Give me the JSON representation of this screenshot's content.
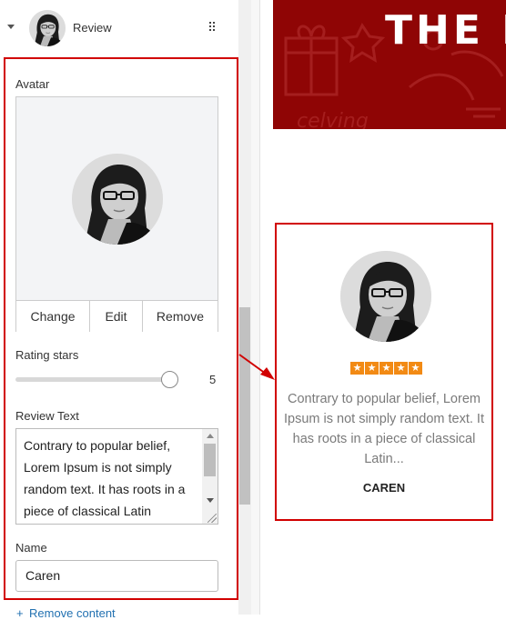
{
  "panel": {
    "header": {
      "title": "Review",
      "thumbnail_icon": "user-avatar-icon"
    },
    "avatar": {
      "label": "Avatar",
      "buttons": [
        "Change",
        "Edit",
        "Remove"
      ]
    },
    "rating": {
      "label": "Rating stars",
      "value": "5",
      "max": 5
    },
    "review_text": {
      "label": "Review Text",
      "value": "Contrary to popular belief, Lorem Ipsum is not simply random text. It has roots in a piece of classical Latin"
    },
    "name": {
      "label": "Name",
      "value": "Caren"
    },
    "remove_content_label": "Remove content"
  },
  "preview": {
    "banner_title": "THE R",
    "card": {
      "stars": 5,
      "text": "Contrary to popular belief, Lorem Ipsum is not simply random text. It has roots in a piece of classical Latin...",
      "name": "CAREN"
    }
  },
  "colors": {
    "highlight": "#d10000",
    "banner": "#8f0505",
    "star": "#f28a14",
    "link": "#2271b1"
  }
}
